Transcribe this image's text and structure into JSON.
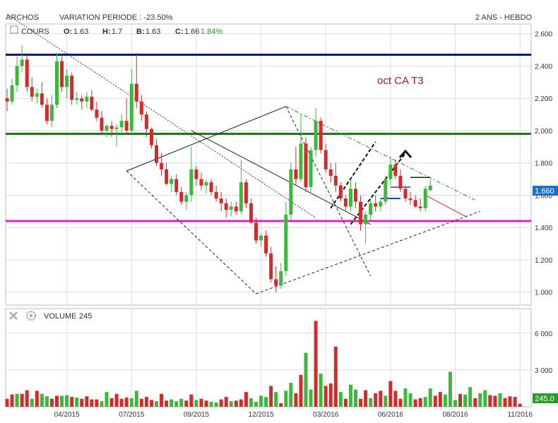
{
  "header": {
    "symbol": "ARCHOS",
    "variation": "VARIATION PERIODE : -23.50%",
    "period": "2 ANS - HEBDO"
  },
  "price_panel": {
    "label": "COURS",
    "open_label": "O:",
    "open": "1.63",
    "high_label": "H:",
    "high": "1.7",
    "low_label": "B:",
    "low": "1.63",
    "close_label": "C:",
    "close": "1.66",
    "change": "1.84%",
    "last_badge": "1.660",
    "annotation": "oct CA T3"
  },
  "volume_panel": {
    "label": "VOLUME",
    "value": "245",
    "last_badge": "245.0"
  },
  "colors": {
    "up": "#3cb93c",
    "down": "#d42a2a",
    "resistance": "#0a1a78",
    "support_green": "#1a7a1a",
    "support_magenta": "#e020c0",
    "grid": "#dcdcdc",
    "badge_price": "#1f6fc0",
    "badge_volume": "#2a9a2a"
  },
  "chart_data": [
    {
      "type": "candlestick",
      "title": "ARCHOS",
      "ylim": [
        0.92,
        2.66
      ],
      "y_ticks": [
        1.0,
        1.2,
        1.4,
        1.6,
        1.8,
        2.0,
        2.2,
        2.4,
        2.6
      ],
      "y_tick_labels": [
        "1.000",
        "1.200",
        "1.400",
        "1.600",
        "1.800",
        "2.000",
        "2.200",
        "2.400",
        "2.600"
      ],
      "x_ticks": [
        "04/2015",
        "07/2015",
        "09/2015",
        "12/2015",
        "03/2016",
        "06/2016",
        "08/2016",
        "11/2016"
      ],
      "x_tick_week": [
        13,
        26,
        39,
        52,
        65,
        78,
        91,
        104
      ],
      "horizontal_levels": [
        {
          "value": 2.47,
          "color": "resistance"
        },
        {
          "value": 1.98,
          "color": "support_green"
        },
        {
          "value": 1.44,
          "color": "support_magenta"
        }
      ],
      "candles": [
        [
          2.2,
          2.26,
          2.12,
          2.18
        ],
        [
          2.18,
          2.32,
          2.16,
          2.28
        ],
        [
          2.28,
          2.46,
          2.24,
          2.4
        ],
        [
          2.4,
          2.53,
          2.36,
          2.44
        ],
        [
          2.44,
          2.47,
          2.24,
          2.27
        ],
        [
          2.27,
          2.33,
          2.18,
          2.21
        ],
        [
          2.21,
          2.26,
          2.17,
          2.23
        ],
        [
          2.23,
          2.3,
          2.14,
          2.16
        ],
        [
          2.16,
          2.2,
          2.04,
          2.06
        ],
        [
          2.06,
          2.22,
          2.02,
          2.16
        ],
        [
          2.16,
          2.48,
          2.14,
          2.43
        ],
        [
          2.43,
          2.46,
          2.24,
          2.27
        ],
        [
          2.27,
          2.38,
          2.2,
          2.34
        ],
        [
          2.34,
          2.36,
          2.16,
          2.19
        ],
        [
          2.19,
          2.24,
          2.16,
          2.2
        ],
        [
          2.2,
          2.22,
          2.13,
          2.18
        ],
        [
          2.18,
          2.24,
          2.14,
          2.21
        ],
        [
          2.21,
          2.25,
          2.12,
          2.13
        ],
        [
          2.13,
          2.18,
          2.06,
          2.08
        ],
        [
          2.08,
          2.12,
          1.98,
          2.0
        ],
        [
          2.0,
          2.04,
          1.96,
          2.03
        ],
        [
          2.03,
          2.06,
          1.96,
          2.01
        ],
        [
          2.01,
          2.04,
          1.9,
          2.02
        ],
        [
          2.02,
          2.1,
          1.98,
          2.06
        ],
        [
          2.06,
          2.2,
          1.98,
          2.0
        ],
        [
          2.0,
          2.38,
          1.98,
          2.29
        ],
        [
          2.29,
          2.48,
          2.14,
          2.18
        ],
        [
          2.18,
          2.22,
          2.06,
          2.1
        ],
        [
          2.1,
          2.12,
          1.96,
          2.01
        ],
        [
          2.01,
          2.02,
          1.89,
          1.91
        ],
        [
          1.91,
          1.95,
          1.78,
          1.8
        ],
        [
          1.8,
          1.86,
          1.72,
          1.76
        ],
        [
          1.76,
          1.8,
          1.66,
          1.67
        ],
        [
          1.67,
          1.72,
          1.62,
          1.7
        ],
        [
          1.7,
          1.73,
          1.6,
          1.62
        ],
        [
          1.62,
          1.65,
          1.54,
          1.56
        ],
        [
          1.56,
          1.62,
          1.51,
          1.6
        ],
        [
          1.6,
          1.9,
          1.56,
          1.76
        ],
        [
          1.76,
          1.78,
          1.66,
          1.7
        ],
        [
          1.7,
          1.74,
          1.63,
          1.66
        ],
        [
          1.66,
          1.7,
          1.61,
          1.68
        ],
        [
          1.68,
          1.7,
          1.6,
          1.62
        ],
        [
          1.62,
          1.66,
          1.56,
          1.58
        ],
        [
          1.58,
          1.62,
          1.5,
          1.55
        ],
        [
          1.55,
          1.58,
          1.46,
          1.51
        ],
        [
          1.51,
          1.56,
          1.47,
          1.53
        ],
        [
          1.53,
          1.56,
          1.48,
          1.5
        ],
        [
          1.5,
          1.82,
          1.48,
          1.68
        ],
        [
          1.68,
          1.7,
          1.52,
          1.55
        ],
        [
          1.55,
          1.58,
          1.42,
          1.43
        ],
        [
          1.43,
          1.46,
          1.3,
          1.32
        ],
        [
          1.32,
          1.36,
          1.28,
          1.35
        ],
        [
          1.35,
          1.38,
          1.22,
          1.24
        ],
        [
          1.24,
          1.28,
          1.06,
          1.08
        ],
        [
          1.08,
          1.16,
          1.0,
          1.04
        ],
        [
          1.04,
          1.18,
          1.02,
          1.13
        ],
        [
          1.13,
          1.56,
          1.1,
          1.48
        ],
        [
          1.48,
          1.8,
          1.44,
          1.76
        ],
        [
          1.76,
          1.9,
          1.66,
          1.7
        ],
        [
          1.7,
          2.1,
          1.68,
          1.92
        ],
        [
          1.92,
          1.96,
          1.62,
          1.65
        ],
        [
          1.65,
          1.9,
          1.62,
          1.88
        ],
        [
          1.88,
          2.14,
          1.84,
          2.06
        ],
        [
          2.06,
          2.08,
          1.86,
          1.88
        ],
        [
          1.88,
          1.92,
          1.74,
          1.76
        ],
        [
          1.76,
          1.8,
          1.68,
          1.72
        ],
        [
          1.72,
          1.8,
          1.62,
          1.66
        ],
        [
          1.66,
          1.68,
          1.56,
          1.58
        ],
        [
          1.58,
          1.6,
          1.5,
          1.53
        ],
        [
          1.53,
          1.7,
          1.5,
          1.64
        ],
        [
          1.64,
          1.68,
          1.52,
          1.56
        ],
        [
          1.56,
          1.6,
          1.38,
          1.42
        ],
        [
          1.42,
          1.5,
          1.3,
          1.48
        ],
        [
          1.48,
          1.58,
          1.44,
          1.55
        ],
        [
          1.55,
          1.6,
          1.5,
          1.53
        ],
        [
          1.53,
          1.58,
          1.5,
          1.56
        ],
        [
          1.56,
          1.72,
          1.54,
          1.7
        ],
        [
          1.7,
          1.84,
          1.66,
          1.79
        ],
        [
          1.79,
          1.82,
          1.7,
          1.72
        ],
        [
          1.72,
          1.76,
          1.62,
          1.64
        ],
        [
          1.64,
          1.66,
          1.56,
          1.58
        ],
        [
          1.58,
          1.62,
          1.54,
          1.57
        ],
        [
          1.57,
          1.6,
          1.52,
          1.53
        ],
        [
          1.53,
          1.58,
          1.5,
          1.52
        ],
        [
          1.52,
          1.66,
          1.5,
          1.64
        ],
        [
          1.63,
          1.7,
          1.63,
          1.66
        ]
      ],
      "trendlines": [
        {
          "points": [
            [
              0,
              2.72
            ],
            [
              62,
              1.46
            ]
          ],
          "style": "dotted"
        },
        {
          "points": [
            [
              24,
              1.75
            ],
            [
              56,
              2.15
            ]
          ],
          "style": "solid"
        },
        {
          "points": [
            [
              24,
              1.75
            ],
            [
              50,
              0.99
            ]
          ],
          "style": "dashed"
        },
        {
          "points": [
            [
              50,
              0.99
            ],
            [
              95,
              1.5
            ]
          ],
          "style": "dashed"
        },
        {
          "points": [
            [
              56,
              2.15
            ],
            [
              73,
              1.1
            ]
          ],
          "style": "dashed"
        },
        {
          "points": [
            [
              56,
              2.15
            ],
            [
              94,
              1.57
            ]
          ],
          "style": "dashdot"
        },
        {
          "points": [
            [
              37,
              2.0
            ],
            [
              73,
              1.42
            ]
          ],
          "style": "solid"
        },
        {
          "points": [
            [
              65,
              1.52
            ],
            [
              74,
              1.93
            ]
          ],
          "style": "dashed-bold"
        },
        {
          "points": [
            [
              69,
              1.42
            ],
            [
              80,
              1.86
            ]
          ],
          "style": "dashed-bold"
        }
      ]
    },
    {
      "type": "bar",
      "title": "VOLUME",
      "ylim": [
        0,
        8000
      ],
      "y_ticks": [
        3000,
        6000
      ],
      "y_tick_labels": [
        "3 000",
        "6 000"
      ],
      "values": [
        650,
        1000,
        1050,
        1050,
        1350,
        650,
        1300,
        1050,
        850,
        650,
        900,
        900,
        950,
        800,
        750,
        650,
        850,
        600,
        600,
        450,
        1200,
        700,
        1050,
        650,
        750,
        700,
        1300,
        650,
        800,
        550,
        450,
        1050,
        500,
        600,
        450,
        650,
        500,
        1000,
        550,
        650,
        500,
        400,
        350,
        600,
        800,
        450,
        500,
        600,
        1200,
        700,
        400,
        900,
        800,
        1700,
        1200,
        300,
        1300,
        1950,
        1100,
        2600,
        4400,
        1400,
        7000,
        2700,
        1700,
        1900,
        4900,
        1200,
        650,
        1800,
        1400,
        650,
        1350,
        700,
        1100,
        1300,
        900,
        2100,
        1300,
        650,
        1500,
        1100,
        600,
        700,
        800,
        1500,
        900,
        1200,
        1000,
        2850,
        550,
        1050,
        1000,
        1600,
        700,
        1100,
        1350,
        950,
        900,
        1100,
        700,
        850,
        800,
        245
      ],
      "colors": "ddudduduudduududddduudddduudddudduuuddudduudduddduuuududuudduududdduduuddudduddduudduudduuuduuduuddu"
    }
  ]
}
